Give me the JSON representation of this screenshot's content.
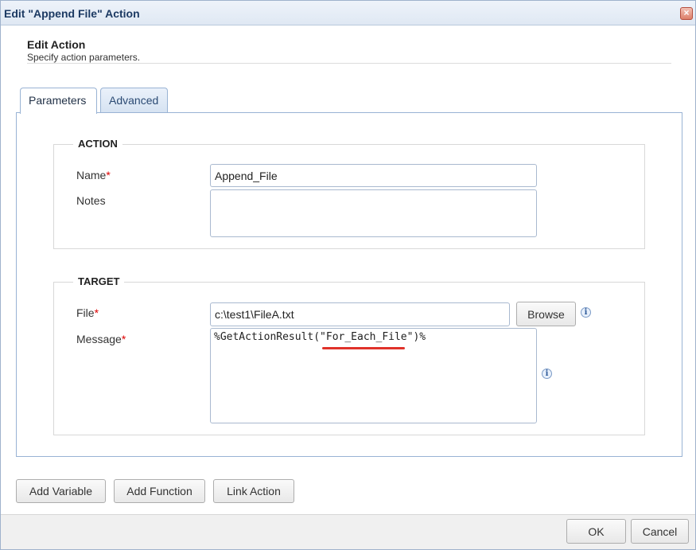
{
  "window": {
    "title": "Edit \"Append File\" Action",
    "close_glyph": "×"
  },
  "header": {
    "title": "Edit Action",
    "subtitle": "Specify action parameters."
  },
  "tabs": [
    {
      "label": "Parameters",
      "active": true
    },
    {
      "label": "Advanced",
      "active": false
    }
  ],
  "action_section": {
    "legend": "ACTION",
    "name_label": "Name",
    "name_value": "Append_File",
    "notes_label": "Notes",
    "notes_value": ""
  },
  "target_section": {
    "legend": "TARGET",
    "file_label": "File",
    "file_value": "c:\\test1\\FileA.txt",
    "browse_label": "Browse",
    "message_label": "Message",
    "message_value": "%GetActionResult(\"For_Each_File\")%"
  },
  "required_mark": "*",
  "info_glyph": "i",
  "bottom_buttons": {
    "add_variable": "Add Variable",
    "add_function": "Add Function",
    "link_action": "Link Action"
  },
  "footer": {
    "ok": "OK",
    "cancel": "Cancel"
  },
  "colors": {
    "accent_border": "#99b3d4",
    "required": "#dd0000",
    "annotation": "#e0322a"
  }
}
